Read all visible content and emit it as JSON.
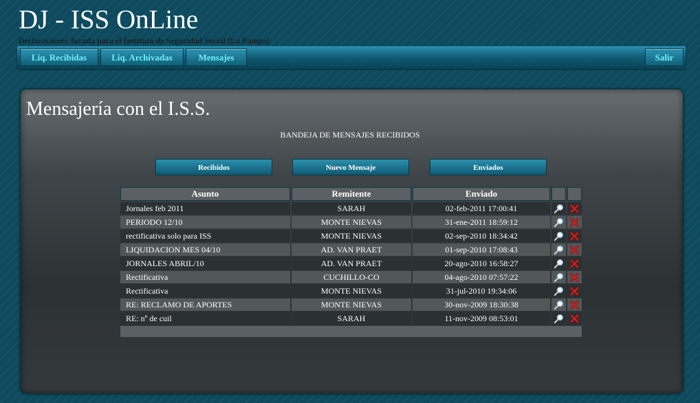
{
  "app": {
    "title": "DJ - ISS OnLine",
    "subtitle": "Declaraciones Jurada para el Instituto de Seguridad Social (La Pampa)"
  },
  "nav": {
    "items": [
      {
        "label": "Liq. Recibidas"
      },
      {
        "label": "Liq. Archivadas"
      },
      {
        "label": "Mensajes"
      }
    ],
    "logout_label": "Salir"
  },
  "page": {
    "title": "Mensajería con el I.S.S.",
    "subtitle": "BANDEJA DE MENSAJES RECIBIDOS"
  },
  "actions": {
    "received_label": "Recibidos",
    "new_label": "Nuevo Mensaje",
    "sent_label": "Enviados"
  },
  "table": {
    "headers": {
      "subject": "Asunto",
      "sender": "Remitente",
      "sent": "Enviado"
    },
    "rows": [
      {
        "subject": "Jornales feb 2011",
        "sender": "SARAH",
        "sent": "02-feb-2011   17:00:41"
      },
      {
        "subject": "PERIODO 12/10",
        "sender": "MONTE NIEVAS",
        "sent": "31-ene-2011   18:59:12"
      },
      {
        "subject": "rectificativa solo para ISS",
        "sender": "MONTE NIEVAS",
        "sent": "02-sep-2010   18:34:42"
      },
      {
        "subject": "LIQUIDACION MES 04/10",
        "sender": "AD. VAN PRAET",
        "sent": "01-sep-2010   17:08:43"
      },
      {
        "subject": "JORNALES ABRIL/10",
        "sender": "AD. VAN PRAET",
        "sent": "20-ago-2010   16:58:27"
      },
      {
        "subject": "Rectificativa",
        "sender": "CUCHILLO-CO",
        "sent": "04-ago-2010   07:57:22"
      },
      {
        "subject": "Rectificativa",
        "sender": "MONTE NIEVAS",
        "sent": "31-jul-2010   19:34:06"
      },
      {
        "subject": "RE: RECLAMO DE APORTES",
        "sender": "MONTE NIEVAS",
        "sent": "30-nov-2009   18:30:38"
      },
      {
        "subject": "RE: nº de cuil",
        "sender": "SARAH",
        "sent": "11-nov-2009   08:53:01"
      }
    ]
  },
  "icons": {
    "view": "magnifier-icon",
    "delete": "delete-x-icon"
  },
  "colors": {
    "accent": "#6ff0ff",
    "delete": "#d81e1e"
  }
}
